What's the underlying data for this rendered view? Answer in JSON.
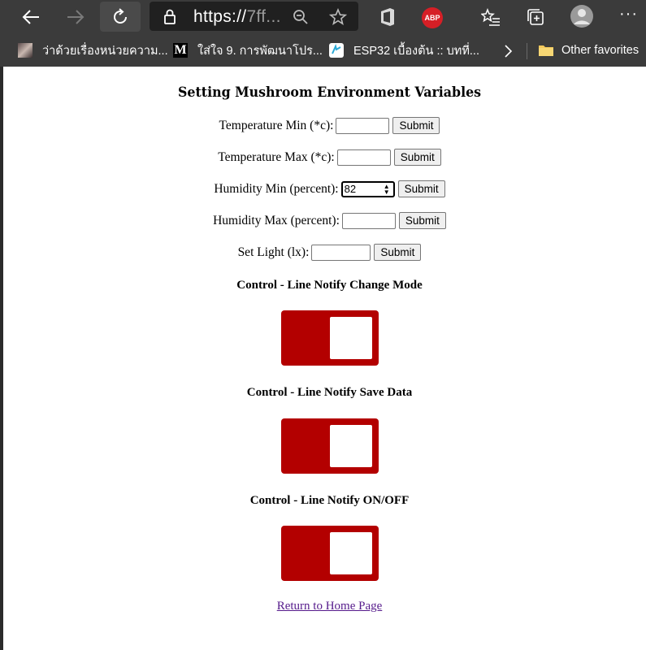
{
  "browser": {
    "url_visible": "https://",
    "url_dim": "7ff...",
    "abp_label": "ABP",
    "bookmarks": [
      {
        "label": "ว่าด้วยเรื่องหน่วยความ...",
        "icon": "photo-favicon-icon"
      },
      {
        "label": "ใส่ใจ 9. การพัฒนาโปร...",
        "icon": "medium-favicon-icon",
        "icon_text": "M"
      },
      {
        "label": "ESP32 เบื้องต้น :: บทที่...",
        "icon": "esp32-favicon-icon"
      }
    ],
    "other_favorites": "Other favorites"
  },
  "page": {
    "title": "Setting Mushroom Environment Variables",
    "forms": [
      {
        "label": "Temperature Min (*c):",
        "value": "",
        "submit": "Submit"
      },
      {
        "label": "Temperature Max (*c):",
        "value": "",
        "submit": "Submit"
      },
      {
        "label": "Humidity Min (percent):",
        "value": "82",
        "submit": "Submit"
      },
      {
        "label": "Humidity Max (percent):",
        "value": "",
        "submit": "Submit"
      },
      {
        "label": "Set Light (lx):",
        "value": "",
        "submit": "Submit"
      }
    ],
    "controls": [
      {
        "title": "Control - Line Notify Change Mode",
        "state": "off"
      },
      {
        "title": "Control - Line Notify Save Data",
        "state": "off"
      },
      {
        "title": "Control - Line Notify ON/OFF",
        "state": "off"
      }
    ],
    "home_link": "Return to Home Page",
    "colors": {
      "switch": "#b30000",
      "link": "#551a8b",
      "chrome": "#3b3b3b"
    }
  }
}
